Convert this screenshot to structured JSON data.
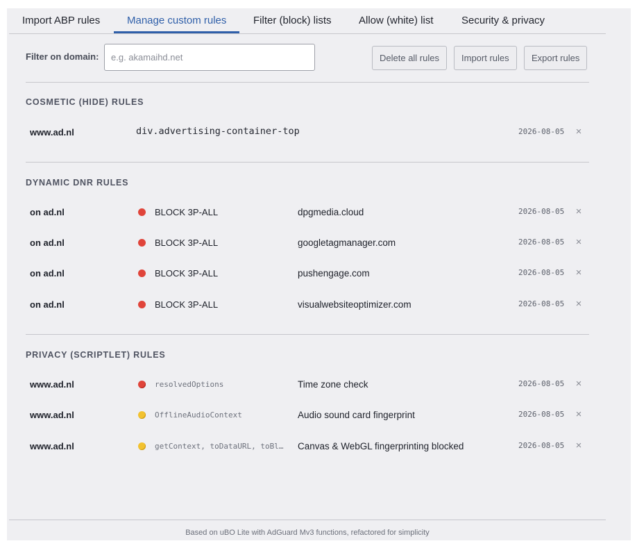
{
  "tabs": [
    {
      "label": "Import ABP rules"
    },
    {
      "label": "Manage custom rules"
    },
    {
      "label": "Filter (block) lists"
    },
    {
      "label": "Allow (white) list"
    },
    {
      "label": "Security & privacy"
    }
  ],
  "active_tab": "Manage custom rules",
  "filter": {
    "label": "Filter on domain:",
    "placeholder": "e.g. akamaihd.net",
    "value": ""
  },
  "buttons": {
    "delete_all": "Delete all rules",
    "import": "Import rules",
    "export": "Export rules"
  },
  "cosmetic": {
    "title": "COSMETIC (HIDE) RULES",
    "rows": [
      {
        "domain": "www.ad.nl",
        "selector": "div.advertising-container-top",
        "date": "2026-08-05",
        "remove": "×"
      }
    ]
  },
  "dnr": {
    "title": "DYNAMIC DNR RULES",
    "rows": [
      {
        "domain": "on ad.nl",
        "action": "BLOCK 3P-ALL",
        "target": "dpgmedia.cloud",
        "date": "2026-08-05",
        "remove": "×",
        "status_color": "#e0443a"
      },
      {
        "domain": "on ad.nl",
        "action": "BLOCK 3P-ALL",
        "target": "googletagmanager.com",
        "date": "2026-08-05",
        "remove": "×",
        "status_color": "#e0443a"
      },
      {
        "domain": "on ad.nl",
        "action": "BLOCK 3P-ALL",
        "target": "pushengage.com",
        "date": "2026-08-05",
        "remove": "×",
        "status_color": "#e0443a"
      },
      {
        "domain": "on ad.nl",
        "action": "BLOCK 3P-ALL",
        "target": "visualwebsiteoptimizer.com",
        "date": "2026-08-05",
        "remove": "×",
        "status_color": "#e0443a"
      }
    ]
  },
  "privacy": {
    "title": "PRIVACY (SCRIPTLET) RULES",
    "rows": [
      {
        "domain": "www.ad.nl",
        "api": "resolvedOptions",
        "description": "Time zone check",
        "date": "2026-08-05",
        "remove": "×",
        "status": "red"
      },
      {
        "domain": "www.ad.nl",
        "api": "OfflineAudioContext",
        "description": "Audio sound card fingerprint",
        "date": "2026-08-05",
        "remove": "×",
        "status": "yellow"
      },
      {
        "domain": "www.ad.nl",
        "api": "getContext, toDataURL, toBlob",
        "description": "Canvas & WebGL fingerprinting blocked",
        "date": "2026-08-05",
        "remove": "×",
        "status": "yellow"
      }
    ]
  },
  "footer": "Based on uBO Lite with AdGuard Mv3 functions, refactored for simplicity"
}
